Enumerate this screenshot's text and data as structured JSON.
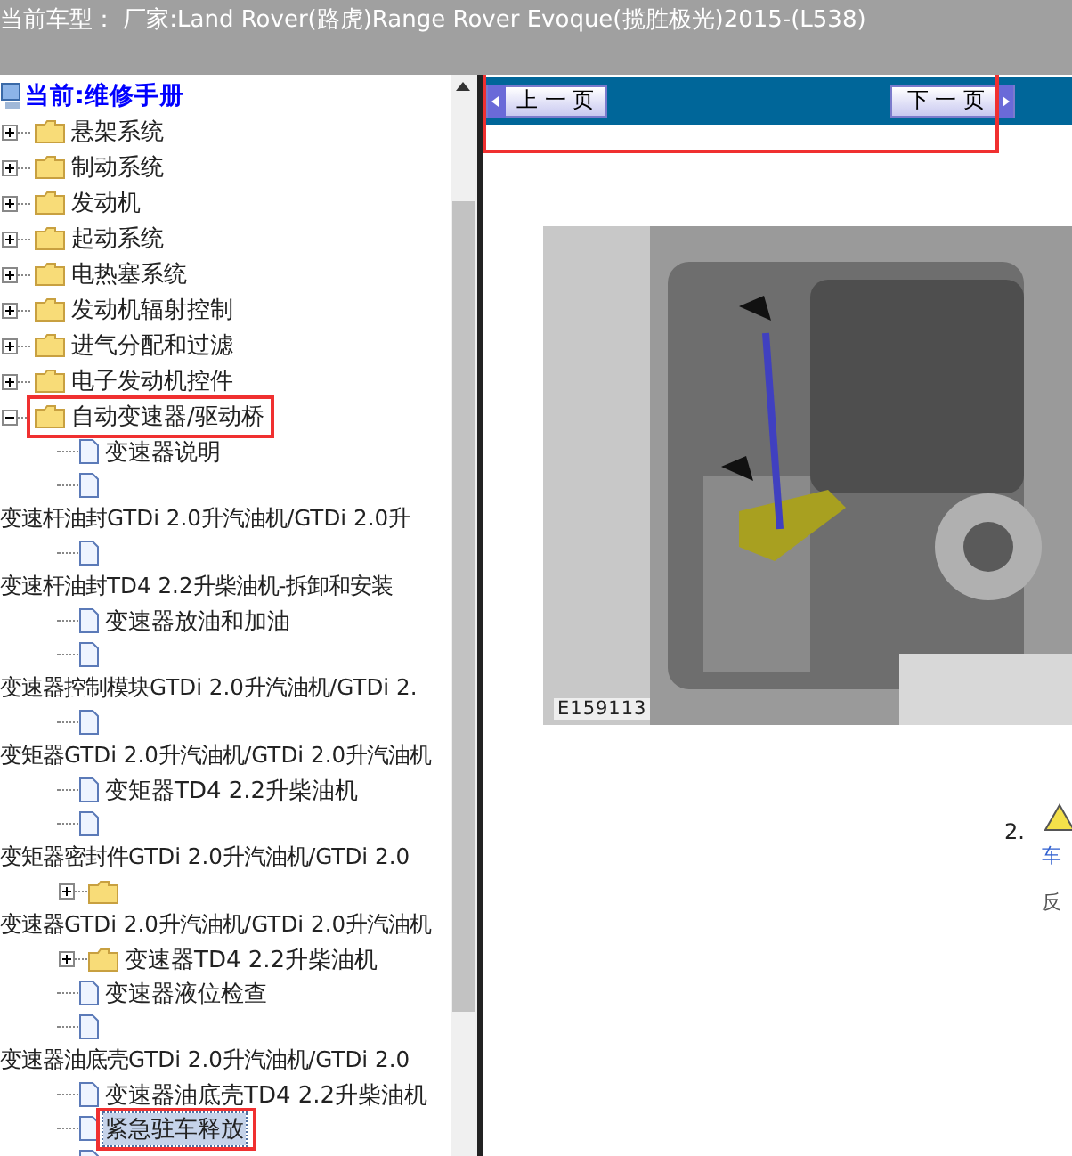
{
  "header": {
    "title": "当前车型： 厂家:Land Rover(路虎)Range Rover Evoque(揽胜极光)2015-(L538)"
  },
  "tree": {
    "root": "当前:维修手册",
    "items": [
      {
        "label": "悬架系统",
        "expanded": false,
        "highlighted": false
      },
      {
        "label": "制动系统",
        "expanded": false,
        "highlighted": false
      },
      {
        "label": "发动机",
        "expanded": false,
        "highlighted": false
      },
      {
        "label": "起动系统",
        "expanded": false,
        "highlighted": false
      },
      {
        "label": "电热塞系统",
        "expanded": false,
        "highlighted": false
      },
      {
        "label": "发动机辐射控制",
        "expanded": false,
        "highlighted": false
      },
      {
        "label": "进气分配和过滤",
        "expanded": false,
        "highlighted": false
      },
      {
        "label": "电子发动机控件",
        "expanded": false,
        "highlighted": false
      },
      {
        "label": "自动变速器/驱动桥",
        "expanded": true,
        "highlighted": true,
        "children": [
          {
            "kind": "doc",
            "label": "变速器说明",
            "wrapped": false,
            "selected": false,
            "highlighted": false
          },
          {
            "kind": "doc",
            "label": "变速杆油封GTDi 2.0升汽油机/GTDi 2.0升",
            "wrapped": true,
            "selected": false,
            "highlighted": false
          },
          {
            "kind": "doc",
            "label": "变速杆油封TD4 2.2升柴油机-拆卸和安装",
            "wrapped": true,
            "selected": false,
            "highlighted": false
          },
          {
            "kind": "doc",
            "label": "变速器放油和加油",
            "wrapped": false,
            "selected": false,
            "highlighted": false
          },
          {
            "kind": "doc",
            "label": "变速器控制模块GTDi 2.0升汽油机/GTDi 2.",
            "wrapped": true,
            "selected": false,
            "highlighted": false
          },
          {
            "kind": "doc",
            "label": "变矩器GTDi 2.0升汽油机/GTDi 2.0升汽油机",
            "wrapped": true,
            "selected": false,
            "highlighted": false
          },
          {
            "kind": "doc",
            "label": "变矩器TD4 2.2升柴油机",
            "wrapped": false,
            "selected": false,
            "highlighted": false
          },
          {
            "kind": "doc",
            "label": "变矩器密封件GTDi 2.0升汽油机/GTDi 2.0",
            "wrapped": true,
            "selected": false,
            "highlighted": false
          },
          {
            "kind": "folder",
            "label": "变速器GTDi 2.0升汽油机/GTDi 2.0升汽油机",
            "wrapped": true,
            "selected": false,
            "highlighted": false
          },
          {
            "kind": "folder",
            "label": "变速器TD4 2.2升柴油机",
            "wrapped": false,
            "selected": false,
            "highlighted": false
          },
          {
            "kind": "doc",
            "label": "变速器液位检查",
            "wrapped": false,
            "selected": false,
            "highlighted": false
          },
          {
            "kind": "doc",
            "label": "变速器油底壳GTDi 2.0升汽油机/GTDi 2.0",
            "wrapped": true,
            "selected": false,
            "highlighted": false
          },
          {
            "kind": "doc",
            "label": "变速器油底壳TD4 2.2升柴油机",
            "wrapped": false,
            "selected": false,
            "highlighted": false
          },
          {
            "kind": "doc",
            "label": "紧急驻车释放",
            "wrapped": false,
            "selected": true,
            "highlighted": true
          },
          {
            "kind": "doc"
          }
        ]
      }
    ]
  },
  "nav": {
    "prev": "上 一 页",
    "next": "下 一 页",
    "highlighted": true
  },
  "document": {
    "figure_label": "E159113",
    "step_number": "2.",
    "step_link": "车",
    "step_text": "反"
  }
}
